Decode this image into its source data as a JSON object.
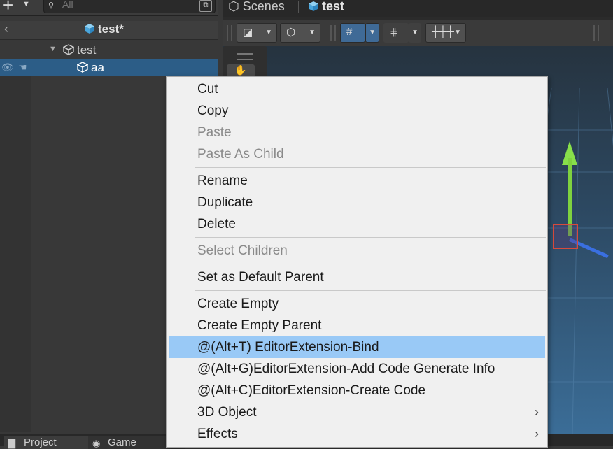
{
  "hierarchy": {
    "search_placeholder": "All",
    "scene_title": "test*",
    "items": [
      {
        "label": "test"
      },
      {
        "label": "aa"
      }
    ]
  },
  "scene_view": {
    "tabs": [
      {
        "label": "Scenes"
      },
      {
        "label": "test"
      }
    ]
  },
  "bottom_tabs": [
    {
      "label": "Project"
    },
    {
      "label": "Game"
    }
  ],
  "context_menu": {
    "groups": [
      [
        {
          "label": "Cut",
          "enabled": true
        },
        {
          "label": "Copy",
          "enabled": true
        },
        {
          "label": "Paste",
          "enabled": false
        },
        {
          "label": "Paste As Child",
          "enabled": false
        }
      ],
      [
        {
          "label": "Rename",
          "enabled": true
        },
        {
          "label": "Duplicate",
          "enabled": true
        },
        {
          "label": "Delete",
          "enabled": true
        }
      ],
      [
        {
          "label": "Select Children",
          "enabled": false
        }
      ],
      [
        {
          "label": "Set as Default Parent",
          "enabled": true
        }
      ],
      [
        {
          "label": "Create Empty",
          "enabled": true
        },
        {
          "label": "Create Empty Parent",
          "enabled": true
        },
        {
          "label": "@(Alt+T) EditorExtension-Bind",
          "enabled": true,
          "highlighted": true
        },
        {
          "label": "@(Alt+G)EditorExtension-Add Code Generate Info",
          "enabled": true
        },
        {
          "label": "@(Alt+C)EditorExtension-Create Code",
          "enabled": true
        },
        {
          "label": "3D Object",
          "enabled": true,
          "submenu": true
        },
        {
          "label": "Effects",
          "enabled": true,
          "submenu": true
        }
      ]
    ]
  },
  "colors": {
    "selection": "#2c5d87",
    "menu_highlight": "#99c9f6",
    "menu_background": "#f0f0f0",
    "active_toolbar_button": "#3f6a96",
    "cube_icon": "#5ab4e6"
  }
}
